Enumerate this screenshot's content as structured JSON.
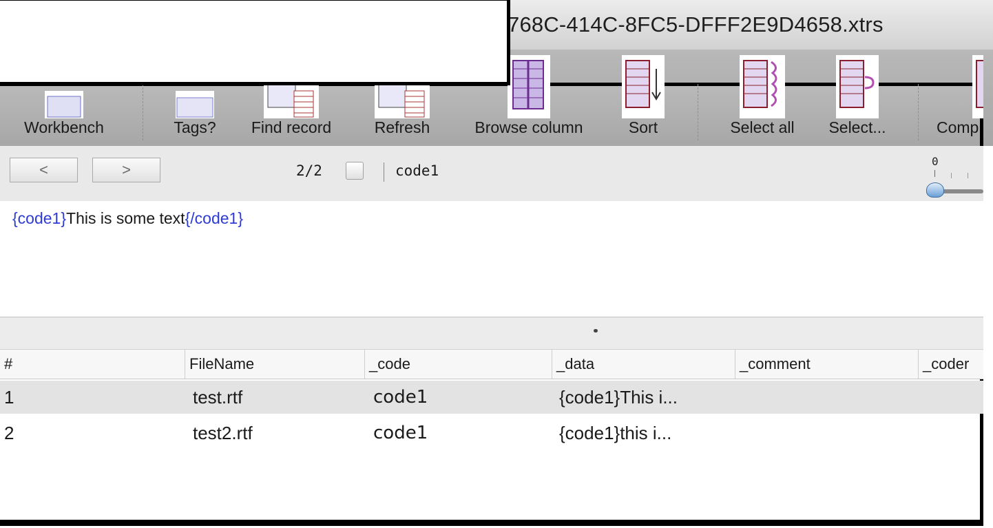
{
  "window": {
    "title_fragment": "768C-414C-8FC5-DFFF2E9D4658.xtrs"
  },
  "toolbar": {
    "items": [
      {
        "label": "Workbench"
      },
      {
        "label": "Tags?"
      },
      {
        "label": "Find record"
      },
      {
        "label": "Refresh"
      },
      {
        "label": "Browse column"
      },
      {
        "label": "Sort"
      },
      {
        "label": "Select all"
      },
      {
        "label": "Select..."
      },
      {
        "label": "Comp"
      }
    ]
  },
  "nav": {
    "prev_label": "<",
    "next_label": ">",
    "record_position": "2/2",
    "current_code": "code1",
    "zoom_min_label": "0"
  },
  "textview": {
    "open_tag": "{code1}",
    "body": "This is some text",
    "close_tag": "{/code1}"
  },
  "table": {
    "columns": [
      "#",
      "FileName",
      "_code",
      "_data",
      "_comment",
      "_coder"
    ],
    "rows": [
      {
        "num": "1",
        "filename": "test.rtf",
        "code": "code1",
        "data": "{code1}This i...",
        "selected": true
      },
      {
        "num": "2",
        "filename": "test2.rtf",
        "code": "code1",
        "data": "{code1}this i...",
        "selected": false
      }
    ]
  },
  "colors": {
    "tag_blue": "#2d3bd4",
    "selected_row": "#e3e3e3",
    "icon_purple": "#b04fb0"
  }
}
